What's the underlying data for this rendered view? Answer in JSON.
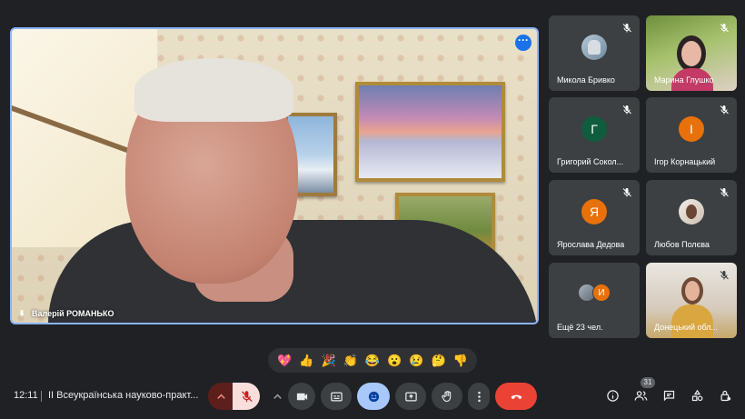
{
  "main_speaker": {
    "name": "Валерій РОМАНЬКО"
  },
  "participants": [
    {
      "name": "Микола Бривко",
      "initial": "",
      "avatar_color": ""
    },
    {
      "name": "Марина Глушко",
      "initial": "",
      "avatar_color": ""
    },
    {
      "name": "Григорий Сокол...",
      "initial": "Г",
      "avatar_color": "#0f5d3e"
    },
    {
      "name": "Ігор Корнацький",
      "initial": "І",
      "avatar_color": "#e8710a"
    },
    {
      "name": "Ярослава Дедова",
      "initial": "Я",
      "avatar_color": "#e8710a"
    },
    {
      "name": "Любов Полєва",
      "initial": "",
      "avatar_color": ""
    },
    {
      "name": "Ещё 23 чел.",
      "initial": "И",
      "avatar_color": "#e8710a"
    },
    {
      "name": "Донецький обл...",
      "initial": "",
      "avatar_color": ""
    }
  ],
  "reactions": [
    "💖",
    "👍",
    "🎉",
    "👏",
    "😂",
    "😮",
    "😢",
    "🤔",
    "👎"
  ],
  "bottom_bar": {
    "time": "12:11",
    "meeting_title": "II Всеукраїнська науково-практ...",
    "participants_count": "31"
  }
}
